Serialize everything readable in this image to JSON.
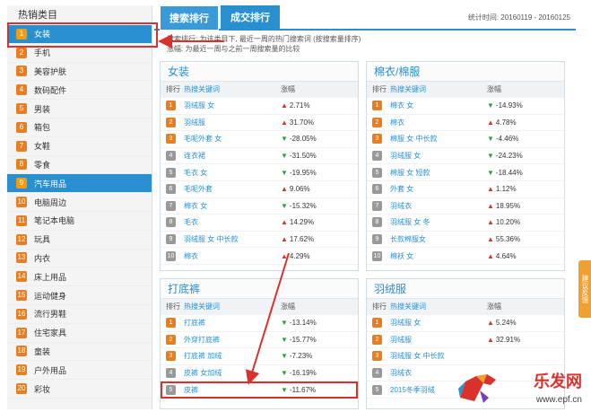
{
  "sidebar": {
    "title": "热销类目",
    "items": [
      {
        "num": "1",
        "label": "女装"
      },
      {
        "num": "2",
        "label": "手机"
      },
      {
        "num": "3",
        "label": "美容护肤"
      },
      {
        "num": "4",
        "label": "数码配件"
      },
      {
        "num": "5",
        "label": "男装"
      },
      {
        "num": "6",
        "label": "箱包"
      },
      {
        "num": "7",
        "label": "女鞋"
      },
      {
        "num": "8",
        "label": "零食"
      },
      {
        "num": "9",
        "label": "汽车用品"
      },
      {
        "num": "10",
        "label": "电脑周边"
      },
      {
        "num": "11",
        "label": "笔记本电脑"
      },
      {
        "num": "12",
        "label": "玩具"
      },
      {
        "num": "13",
        "label": "内衣"
      },
      {
        "num": "14",
        "label": "床上用品"
      },
      {
        "num": "15",
        "label": "运动健身"
      },
      {
        "num": "16",
        "label": "流行男鞋"
      },
      {
        "num": "17",
        "label": "住宅家具"
      },
      {
        "num": "18",
        "label": "童装"
      },
      {
        "num": "19",
        "label": "户外用品"
      },
      {
        "num": "20",
        "label": "彩妆"
      }
    ]
  },
  "tabs": {
    "search": "搜索排行",
    "deal": "成交排行"
  },
  "stat_time": "统计时间: 20160119 - 20160125",
  "notice": {
    "line1": "搜索排行: 为该类目下, 最近一周的热门搜索词 (按搜索量排序)",
    "line2": "涨幅: 为最近一周与之前一周搜索量的比较"
  },
  "table_headers": {
    "rank": "排行",
    "keyword": "热搜关键词",
    "change": "涨幅"
  },
  "cards": [
    {
      "title": "女装",
      "rows": [
        {
          "rank": "1",
          "kw": "羽绒服 女",
          "dir": "up",
          "chg": "2.71%"
        },
        {
          "rank": "2",
          "kw": "羽绒服",
          "dir": "up",
          "chg": "31.70%"
        },
        {
          "rank": "3",
          "kw": "毛呢外套 女",
          "dir": "down",
          "chg": "-28.05%"
        },
        {
          "rank": "4",
          "kw": "连衣裙",
          "dir": "down",
          "chg": "-31.50%"
        },
        {
          "rank": "5",
          "kw": "毛衣 女",
          "dir": "down",
          "chg": "-19.95%"
        },
        {
          "rank": "6",
          "kw": "毛呢外套",
          "dir": "up",
          "chg": "9.06%"
        },
        {
          "rank": "7",
          "kw": "棉衣 女",
          "dir": "down",
          "chg": "-15.32%"
        },
        {
          "rank": "8",
          "kw": "毛衣",
          "dir": "up",
          "chg": "14.29%"
        },
        {
          "rank": "9",
          "kw": "羽绒服 女 中长款",
          "dir": "up",
          "chg": "17.62%"
        },
        {
          "rank": "10",
          "kw": "棉衣",
          "dir": "up",
          "chg": "4.29%"
        }
      ]
    },
    {
      "title": "棉衣/棉服",
      "rows": [
        {
          "rank": "1",
          "kw": "棉衣 女",
          "dir": "down",
          "chg": "-14.93%"
        },
        {
          "rank": "2",
          "kw": "棉衣",
          "dir": "up",
          "chg": "4.78%"
        },
        {
          "rank": "3",
          "kw": "棉服 女 中长款",
          "dir": "down",
          "chg": "-4.46%"
        },
        {
          "rank": "4",
          "kw": "羽绒服 女",
          "dir": "down",
          "chg": "-24.23%"
        },
        {
          "rank": "5",
          "kw": "棉服 女 短款",
          "dir": "down",
          "chg": "-18.44%"
        },
        {
          "rank": "6",
          "kw": "外套 女",
          "dir": "up",
          "chg": "1.12%"
        },
        {
          "rank": "7",
          "kw": "羽绒衣",
          "dir": "up",
          "chg": "18.95%"
        },
        {
          "rank": "8",
          "kw": "羽绒服 女 冬",
          "dir": "up",
          "chg": "10.20%"
        },
        {
          "rank": "9",
          "kw": "长款棉服女",
          "dir": "up",
          "chg": "55.36%"
        },
        {
          "rank": "10",
          "kw": "棉袄 女",
          "dir": "up",
          "chg": "4.64%"
        }
      ]
    },
    {
      "title": "打底裤",
      "rows": [
        {
          "rank": "1",
          "kw": "打底裤",
          "dir": "down",
          "chg": "-13.14%"
        },
        {
          "rank": "2",
          "kw": "外穿打底裤",
          "dir": "down",
          "chg": "-15.77%"
        },
        {
          "rank": "3",
          "kw": "打底裤 加绒",
          "dir": "down",
          "chg": "-7.23%"
        },
        {
          "rank": "4",
          "kw": "皮裤 女加绒",
          "dir": "down",
          "chg": "-16.19%"
        },
        {
          "rank": "5",
          "kw": "皮裤",
          "dir": "down",
          "chg": "-11.67%"
        }
      ]
    },
    {
      "title": "羽绒服",
      "rows": [
        {
          "rank": "1",
          "kw": "羽绒服 女",
          "dir": "up",
          "chg": "5.24%"
        },
        {
          "rank": "2",
          "kw": "羽绒服",
          "dir": "up",
          "chg": "32.91%"
        },
        {
          "rank": "3",
          "kw": "羽绒服 女 中长款",
          "dir": "",
          "chg": ""
        },
        {
          "rank": "4",
          "kw": "羽绒衣",
          "dir": "",
          "chg": ""
        },
        {
          "rank": "5",
          "kw": "2015冬季羽绒",
          "dir": "",
          "chg": ""
        }
      ]
    }
  ],
  "feedback": "建议反馈",
  "watermark": {
    "brand": "乐发网",
    "url": "www.epf.cn"
  }
}
